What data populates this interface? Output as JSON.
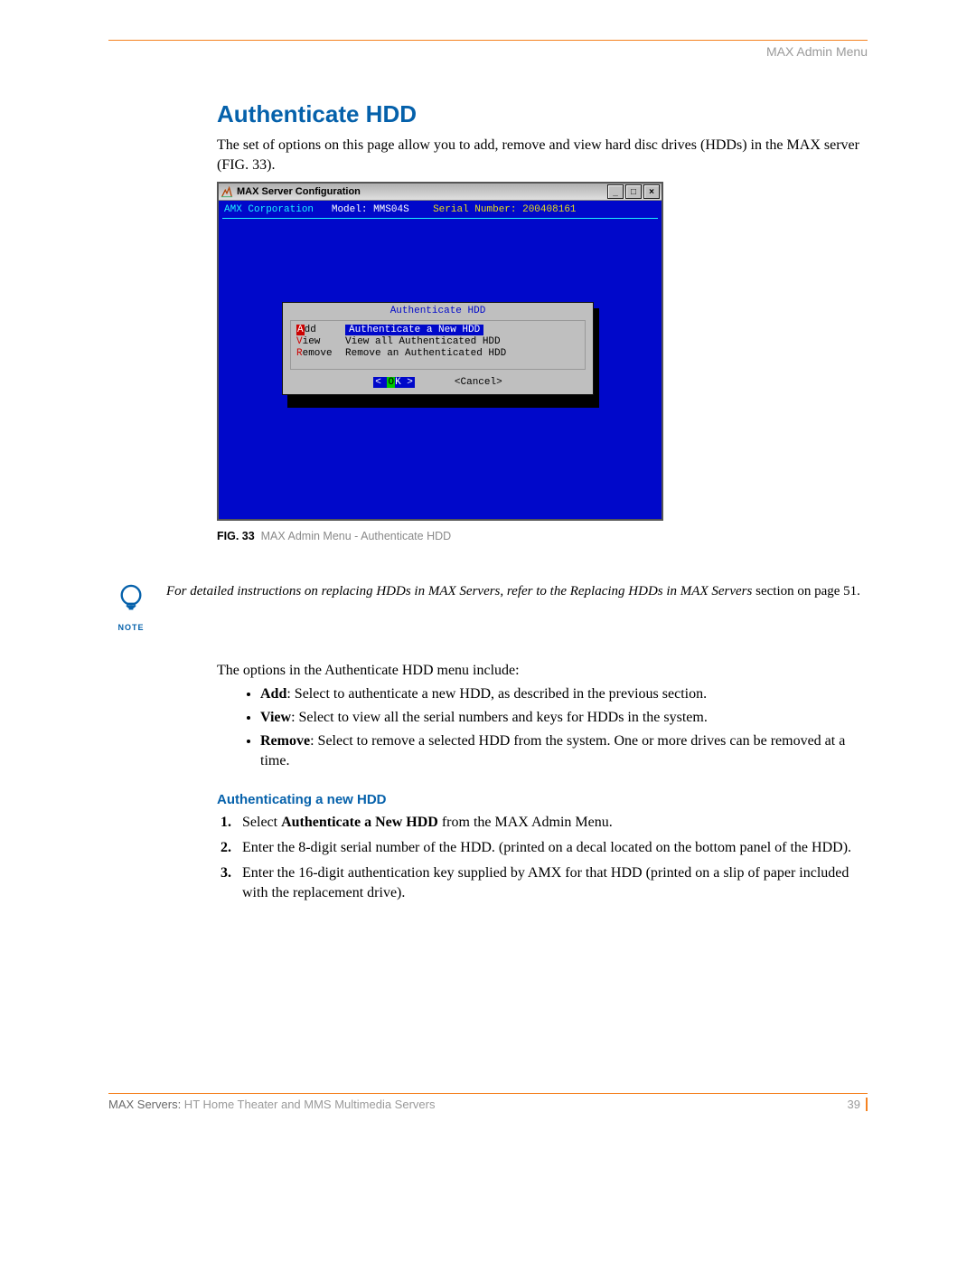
{
  "header": {
    "section": "MAX Admin Menu"
  },
  "heading": "Authenticate HDD",
  "intro": "The set of options on this page allow you to add, remove and view hard disc drives (HDDs) in the MAX server (FIG. 33).",
  "screenshot": {
    "window_title": "MAX Server Configuration",
    "terminal_header": {
      "company": "AMX Corporation",
      "model_label": "Model:",
      "model_value": "MMS04S",
      "serial_label": "Serial Number:",
      "serial_value": "200408161"
    },
    "dialog": {
      "title": "Authenticate HDD",
      "items": [
        {
          "key_hot": "A",
          "key_rest": "dd",
          "desc": "Authenticate a New HDD",
          "selected": true
        },
        {
          "key_hot": "V",
          "key_rest": "iew",
          "desc": "View all Authenticated HDD",
          "selected": false
        },
        {
          "key_hot": "R",
          "key_rest": "emove",
          "desc": "Remove an Authenticated HDD",
          "selected": false
        }
      ],
      "ok_left": "<",
      "ok_hot": "O",
      "ok_rest": "K",
      "ok_right": " >",
      "cancel": "<Cancel>"
    }
  },
  "caption": {
    "fig": "FIG. 33",
    "text": "MAX Admin Menu - Authenticate HDD"
  },
  "note": {
    "label": "NOTE",
    "text_italic": "For detailed instructions on replacing HDDs in MAX Servers, refer to the Replacing HDDs in MAX Servers",
    "text_upright": " section on page 51."
  },
  "options_lead": "The options in the Authenticate HDD menu include:",
  "bullets": [
    {
      "b": "Add",
      "rest": ": Select to authenticate a new HDD, as described in the previous section."
    },
    {
      "b": "View",
      "rest": ": Select to view all the serial numbers and keys for HDDs in the system."
    },
    {
      "b": "Remove",
      "rest": ": Select to remove a selected HDD from the system. One or more drives can be removed at a time."
    }
  ],
  "subheading": "Authenticating a new HDD",
  "steps": [
    {
      "pre": "Select ",
      "b": "Authenticate a New HDD",
      "post": " from the MAX Admin Menu."
    },
    {
      "pre": "Enter the 8-digit serial number of the HDD. (printed on a decal located on the bottom panel of the HDD).",
      "b": "",
      "post": ""
    },
    {
      "pre": "Enter the 16-digit authentication key supplied by AMX for that HDD (printed on a slip of paper included with the replacement drive).",
      "b": "",
      "post": ""
    }
  ],
  "footer": {
    "left_dark": "MAX Servers:",
    "left_rest": " HT Home Theater and MMS Multimedia Servers",
    "page": "39"
  }
}
